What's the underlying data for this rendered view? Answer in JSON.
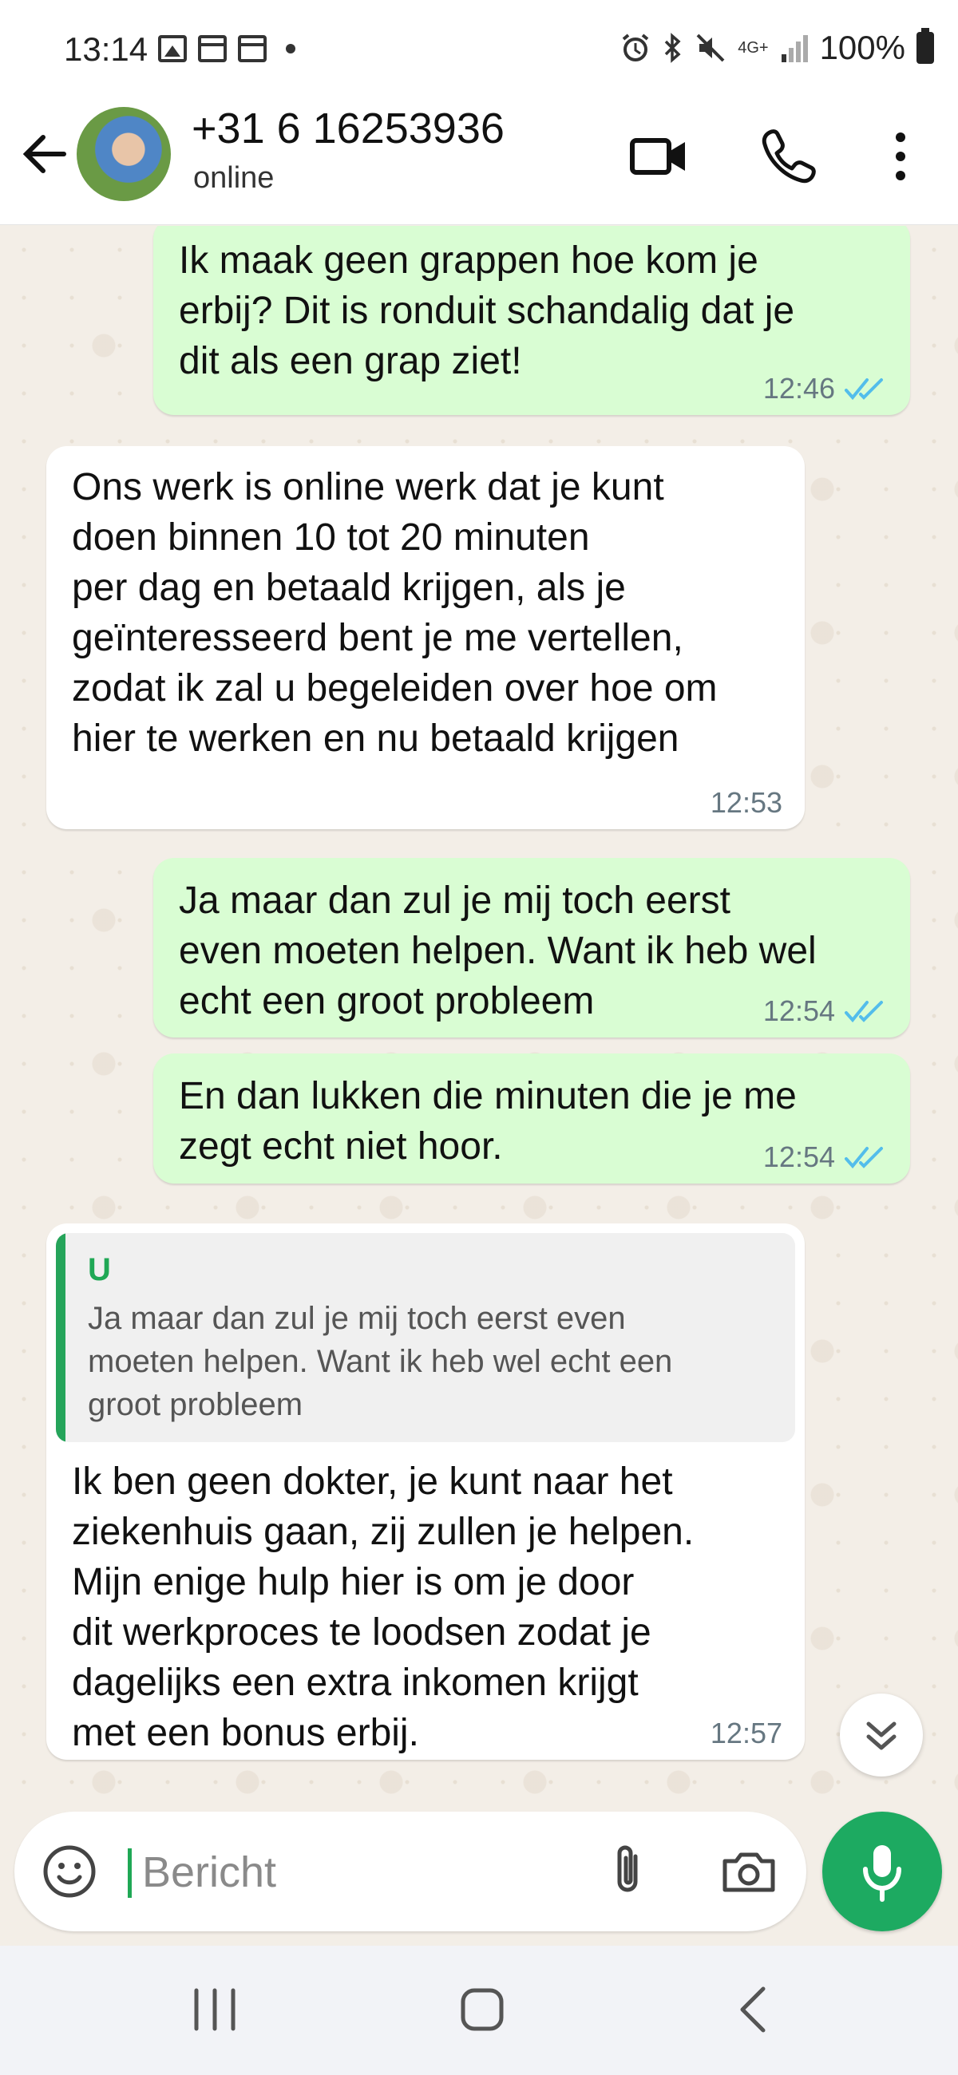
{
  "status_bar": {
    "time": "13:14",
    "network": "4G+",
    "battery": "100%"
  },
  "header": {
    "contact_name": "+31 6 16253936",
    "status": "online",
    "back_icon": "arrow-left-icon",
    "video_icon": "video-camera-icon",
    "call_icon": "phone-icon",
    "menu_icon": "more-vertical-icon"
  },
  "messages": [
    {
      "direction": "outgoing",
      "text": "Ik maak geen grappen hoe kom je\nerbij? Dit is ronduit schandalig dat je\ndit als een grap ziet!",
      "time": "12:46",
      "status": "read"
    },
    {
      "direction": "incoming",
      "text": "Ons werk is online werk dat je kunt\ndoen binnen 10 tot 20 minuten\nper dag en betaald krijgen, als je\ngeïnteresseerd bent je me vertellen,\nzodat ik zal u begeleiden over hoe om\nhier te werken en nu betaald krijgen",
      "time": "12:53"
    },
    {
      "direction": "outgoing",
      "text": "Ja maar dan zul je mij toch eerst\neven moeten helpen. Want ik heb wel\necht een groot probleem",
      "time": "12:54",
      "status": "read"
    },
    {
      "direction": "outgoing",
      "text": "En dan lukken die minuten die je me\nzegt echt niet hoor.",
      "time": "12:54",
      "status": "read"
    },
    {
      "direction": "incoming",
      "quote": {
        "author": "U",
        "text": "Ja maar dan zul je mij toch eerst even\nmoeten helpen. Want ik heb wel echt een\ngroot probleem"
      },
      "text": "Ik ben geen dokter, je kunt naar het\nziekenhuis gaan, zij zullen je helpen.\nMijn enige hulp hier is om je door\ndit werkproces te loodsen zodat je\ndagelijks een extra inkomen krijgt\nmet een bonus erbij.",
      "time": "12:57"
    }
  ],
  "input": {
    "placeholder": "Bericht",
    "emoji_icon": "smiley-icon",
    "attach_icon": "paperclip-icon",
    "camera_icon": "camera-icon",
    "mic_icon": "microphone-icon"
  },
  "colors": {
    "outgoing_bubble": "#d9fdd3",
    "incoming_bubble": "#ffffff",
    "accent": "#1daa61",
    "read_ticks": "#53bdeb",
    "chat_background": "#f3eee7"
  }
}
